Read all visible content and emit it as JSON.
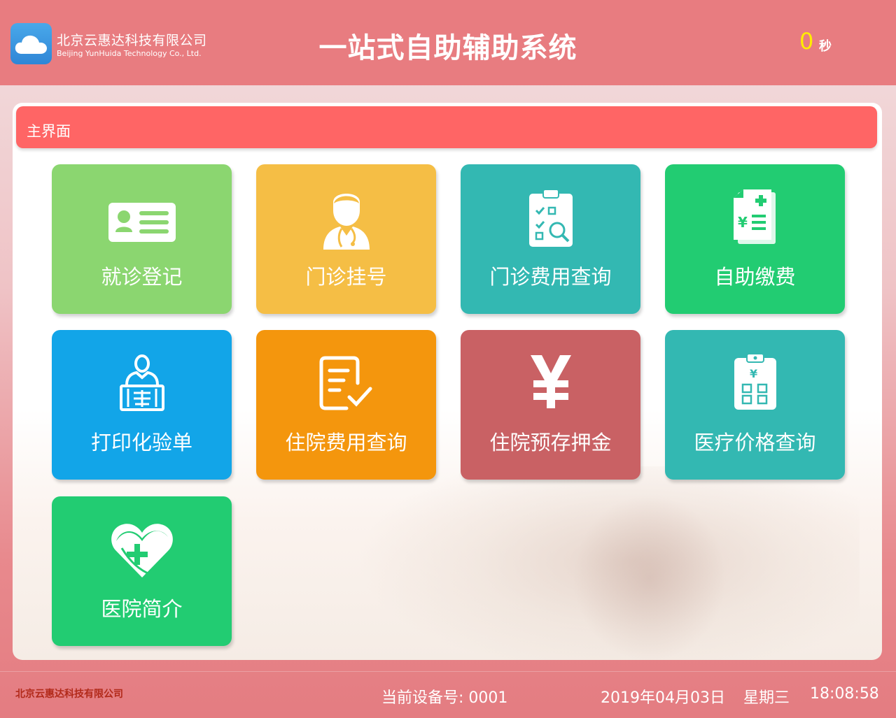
{
  "header": {
    "logo_icon": "cloud-icon",
    "company_cn": "北京云惠达科技有限公司",
    "company_en": "Beijing YunHuida Technology Co., Ltd.",
    "title": "一站式自助辅助系统",
    "countdown_value": "0",
    "countdown_unit": "秒"
  },
  "main": {
    "panel_title": "主界面",
    "tiles": [
      {
        "label": "就诊登记",
        "icon": "id-card-icon",
        "color": "#8bd670"
      },
      {
        "label": "门诊挂号",
        "icon": "doctor-icon",
        "color": "#f5be45"
      },
      {
        "label": "门诊费用查询",
        "icon": "clipboard-search-icon",
        "color": "#33b8b2"
      },
      {
        "label": "自助缴费",
        "icon": "invoice-icon",
        "color": "#22cc72"
      },
      {
        "label": "打印化验单",
        "icon": "person-report-icon",
        "color": "#12a5e8"
      },
      {
        "label": "住院费用查询",
        "icon": "document-check-icon",
        "color": "#f4960d"
      },
      {
        "label": "住院预存押金",
        "icon": "yuan-icon",
        "color": "#c96164"
      },
      {
        "label": "医疗价格查询",
        "icon": "clipboard-price-icon",
        "color": "#33b8b2"
      },
      {
        "label": "医院简介",
        "icon": "heart-plus-icon",
        "color": "#22cc72"
      }
    ]
  },
  "footer": {
    "company": "北京云惠达科技有限公司",
    "device": "当前设备号: 0001",
    "date": "2019年04月03日",
    "weekday": "星期三",
    "time": "18:08:58"
  }
}
